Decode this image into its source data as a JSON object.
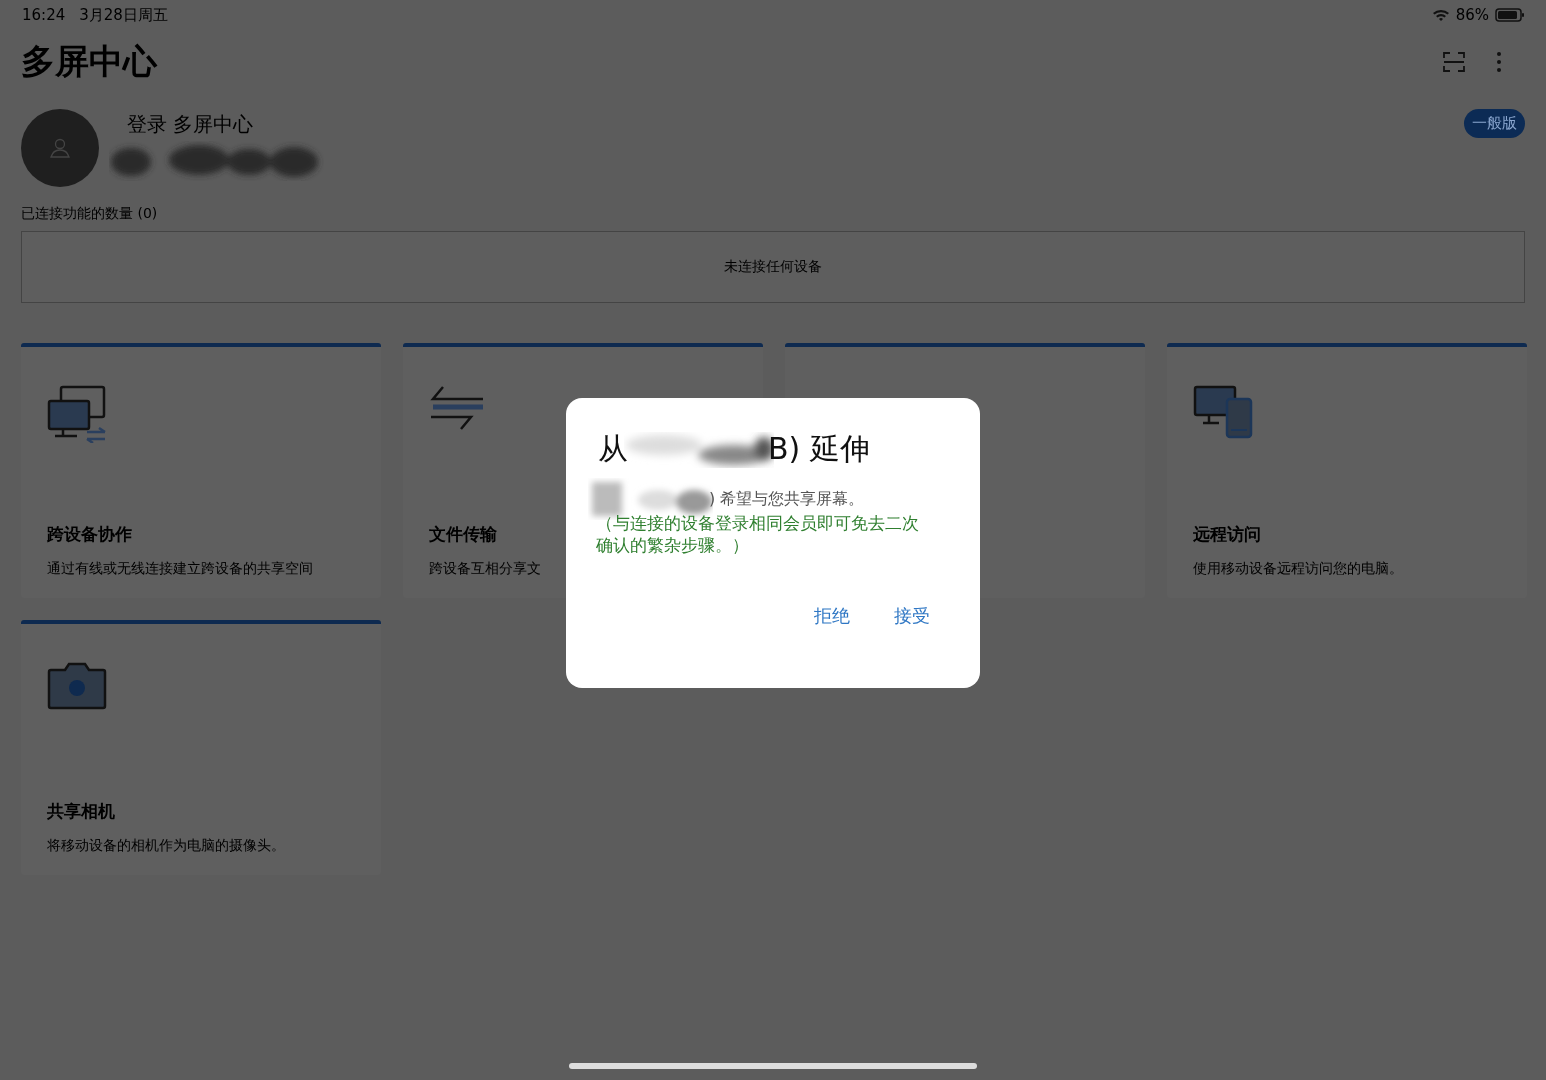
{
  "status_bar": {
    "time": "16:24",
    "date": "3月28日周五",
    "battery": "86%"
  },
  "header": {
    "title": "多屏中心"
  },
  "account": {
    "login_text": "登录 多屏中心",
    "badge": "一般版"
  },
  "connected": {
    "label": "已连接功能的数量 (0)",
    "empty_text": "未连接任何设备"
  },
  "features": [
    {
      "kind": "collab",
      "title": "跨设备协作",
      "description": "通过有线或无线连接建立跨设备的共享空间"
    },
    {
      "kind": "transfer",
      "title": "文件传输",
      "description": "跨设备互相分享文"
    },
    {
      "kind": "covered"
    },
    {
      "kind": "remote",
      "title": "远程访问",
      "description": "使用移动设备远程访问您的电脑。"
    },
    {
      "kind": "camera",
      "title": "共享相机",
      "description": "将移动设备的相机作为电脑的摄像头。"
    }
  ],
  "dialog": {
    "title_start": "从",
    "title_end": "B) 延伸",
    "message": ") 希望与您共享屏幕。",
    "note": "（与连接的设备登录相同会员即可免去二次确认的繁杂步骤。）",
    "buttons": [
      {
        "label": "拒绝"
      },
      {
        "label": "接受"
      }
    ]
  }
}
